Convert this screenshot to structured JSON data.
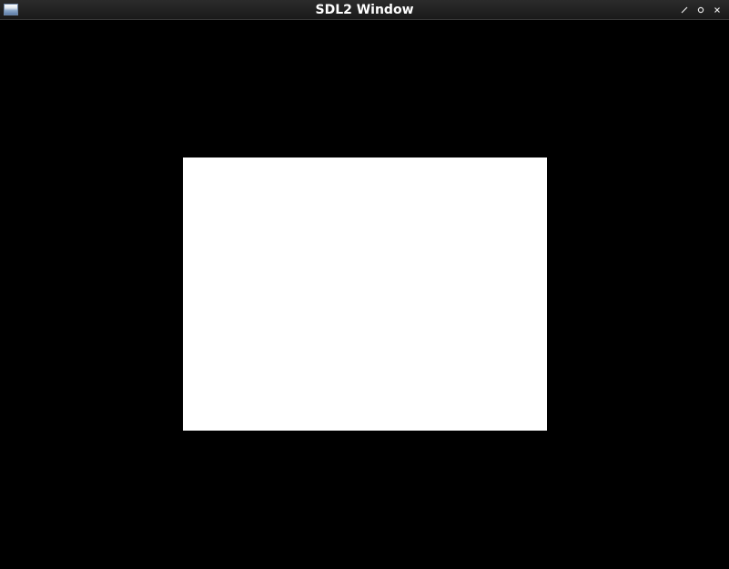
{
  "window": {
    "title": "SDL2 Window",
    "controls": {
      "maximize_icon": "diagonal-resize-icon",
      "restore_icon": "circle-icon",
      "close_icon": "close-icon"
    }
  },
  "canvas": {
    "background_color": "#000000",
    "shape": {
      "type": "rectangle",
      "fill_color": "#ffffff"
    }
  }
}
